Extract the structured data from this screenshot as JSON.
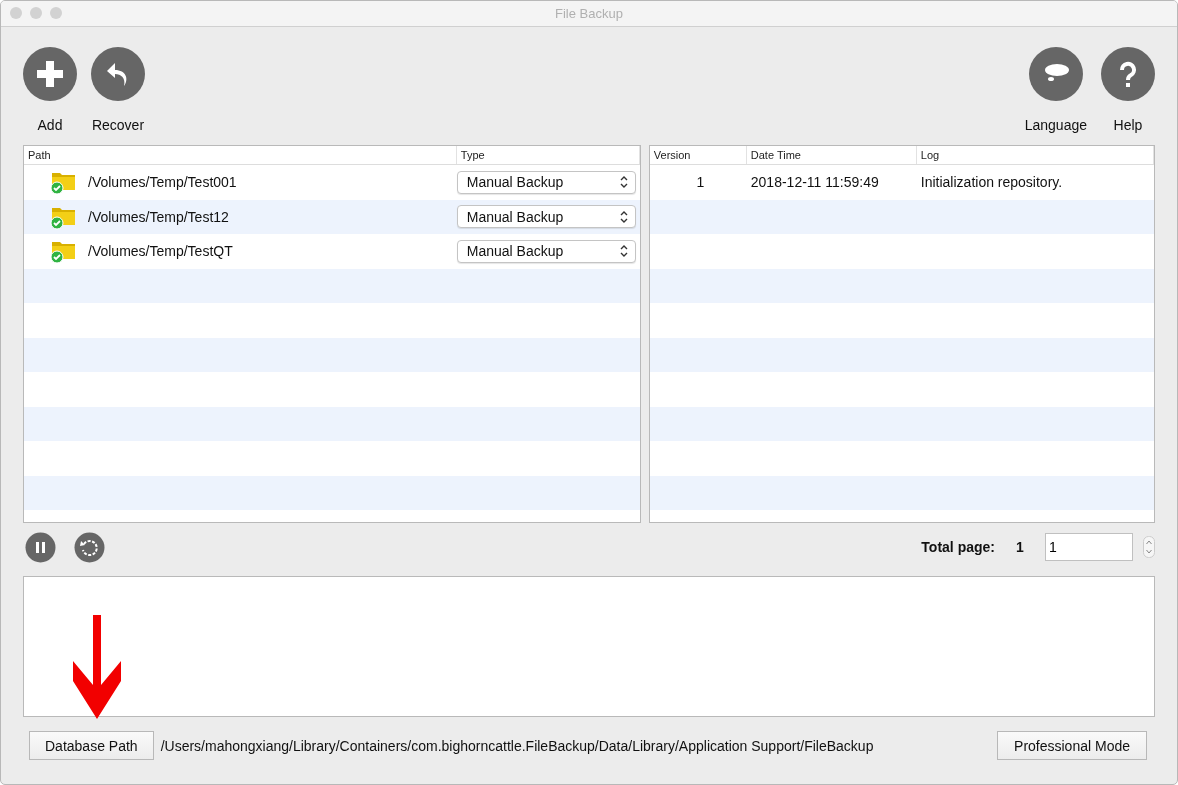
{
  "window": {
    "title": "File Backup"
  },
  "toolbar_left": [
    {
      "kind": "add",
      "label": "Add"
    },
    {
      "kind": "recover",
      "label": "Recover"
    }
  ],
  "toolbar_right": [
    {
      "kind": "language",
      "label": "Language"
    },
    {
      "kind": "help",
      "label": "Help"
    }
  ],
  "paths_table": {
    "columns": [
      "Path",
      "Type"
    ],
    "rows": [
      {
        "path": "/Volumes/Temp/Test001",
        "type": "Manual Backup",
        "synced": true
      },
      {
        "path": "/Volumes/Temp/Test12",
        "type": "Manual Backup",
        "synced": true
      },
      {
        "path": "/Volumes/Temp/TestQT",
        "type": "Manual Backup",
        "synced": true
      }
    ]
  },
  "versions_table": {
    "columns": [
      "Version",
      "Date Time",
      "Log"
    ],
    "rows": [
      {
        "version": "1",
        "date_time": "2018-12-11 11:59:49",
        "log": "Initialization repository."
      }
    ]
  },
  "pager": {
    "label": "Total page:",
    "total": "1",
    "page": "1"
  },
  "database_path": {
    "button": "Database Path",
    "value": "/Users/mahongxiang/Library/Containers/com.bighorncattle.FileBackup/Data/Library/Application Support/FileBackup"
  },
  "mode_button": "Professional Mode"
}
